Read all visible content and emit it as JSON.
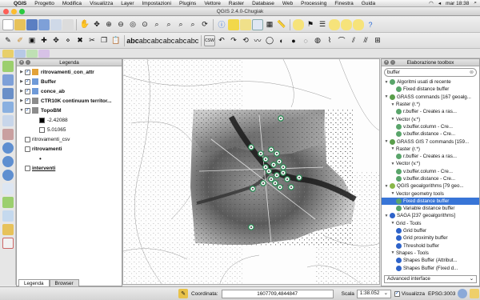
{
  "menubar": {
    "items": [
      "QGIS",
      "Progetto",
      "Modifica",
      "Visualizza",
      "Layer",
      "Impostazioni",
      "Plugins",
      "Vettore",
      "Raster",
      "Database",
      "Web",
      "Processing",
      "Finestra",
      "Guida"
    ],
    "clock": "mar 18:38"
  },
  "window": {
    "title": "QGIS 2.4.0-Chugiak"
  },
  "legend": {
    "title": "Legenda",
    "layers": [
      {
        "name": "ritrovamenti_con_attr",
        "checked": true,
        "bold": true,
        "icon": "point-layer-icon"
      },
      {
        "name": "Buffer",
        "checked": true,
        "bold": true,
        "icon": "polygon-layer-icon"
      },
      {
        "name": "conce_ab",
        "checked": true,
        "bold": true,
        "icon": "polygon-layer-icon"
      },
      {
        "name": "CTR10K continuum territor...",
        "checked": true,
        "bold": true,
        "icon": "raster-layer-icon"
      },
      {
        "name": "TopoBM",
        "checked": true,
        "bold": true,
        "icon": "raster-layer-icon"
      }
    ],
    "topobm_values": [
      "-2.42088",
      "5.01065"
    ],
    "extra_layers": [
      {
        "name": "ritrovamenti_csv",
        "checked": false,
        "bold": false
      },
      {
        "name": "ritrovamenti",
        "checked": false,
        "bold": true
      },
      {
        "name": "interventi",
        "checked": false,
        "bold": true,
        "underline": true
      }
    ],
    "tabs": [
      "Legenda",
      "Browser"
    ]
  },
  "toolbox": {
    "title": "Elaborazione toolbox",
    "search_value": "buffer",
    "tree": [
      {
        "level": 0,
        "label": "Algoritmi usati di recente",
        "icon": "gear-icon"
      },
      {
        "level": 2,
        "label": "Fixed distance buffer",
        "icon": "gear-icon"
      },
      {
        "level": 0,
        "label": "GRASS commands [167 geoalg...",
        "icon": "grass-icon"
      },
      {
        "level": 1,
        "label": "Raster (r.*)",
        "icon": ""
      },
      {
        "level": 2,
        "label": "r.buffer - Creates a ras...",
        "icon": "gear-icon"
      },
      {
        "level": 1,
        "label": "Vector (v.*)",
        "icon": ""
      },
      {
        "level": 2,
        "label": "v.buffer.column - Cre...",
        "icon": "gear-icon"
      },
      {
        "level": 2,
        "label": "v.buffer.distance - Cre...",
        "icon": "gear-icon"
      },
      {
        "level": 0,
        "label": "GRASS GIS 7 commands [159...",
        "icon": "grass-icon"
      },
      {
        "level": 1,
        "label": "Raster (r.*)",
        "icon": ""
      },
      {
        "level": 2,
        "label": "r.buffer - Creates a ras...",
        "icon": "gear-icon"
      },
      {
        "level": 1,
        "label": "Vector (v.*)",
        "icon": ""
      },
      {
        "level": 2,
        "label": "v.buffer.column - Cre...",
        "icon": "gear-icon"
      },
      {
        "level": 2,
        "label": "v.buffer.distance - Cre...",
        "icon": "gear-icon"
      },
      {
        "level": 0,
        "label": "QGIS geoalgorithms [79 geo...",
        "icon": "qgis-icon"
      },
      {
        "level": 1,
        "label": "Vector geometry tools",
        "icon": ""
      },
      {
        "level": 2,
        "label": "Fixed distance buffer",
        "icon": "gear-icon",
        "selected": true
      },
      {
        "level": 2,
        "label": "Variable distance buffer",
        "icon": "gear-icon"
      },
      {
        "level": 0,
        "label": "SAGA [237 geoalgorithms]",
        "icon": "saga-icon"
      },
      {
        "level": 1,
        "label": "Grid - Tools",
        "icon": ""
      },
      {
        "level": 2,
        "label": "Grid buffer",
        "icon": "saga-icon"
      },
      {
        "level": 2,
        "label": "Grid proximity buffer",
        "icon": "saga-icon"
      },
      {
        "level": 2,
        "label": "Threshold buffer",
        "icon": "saga-icon"
      },
      {
        "level": 1,
        "label": "Shapes - Tools",
        "icon": ""
      },
      {
        "level": 2,
        "label": "Shapes Buffer (Attribut...",
        "icon": "saga-icon"
      },
      {
        "level": 2,
        "label": "Shapes Buffer (Fixed d...",
        "icon": "saga-icon"
      }
    ],
    "interface_select": "Advanced interface"
  },
  "status": {
    "coord_label": "Coordinata:",
    "coord_value": "1607709,4844847",
    "scale_label": "Scala",
    "scale_value": "1:38.052",
    "render_label": "Visualizza",
    "crs_label": "EPSG:3003"
  },
  "colors": {
    "selection": "#3875d7",
    "point_marker": "#2e8b57"
  }
}
